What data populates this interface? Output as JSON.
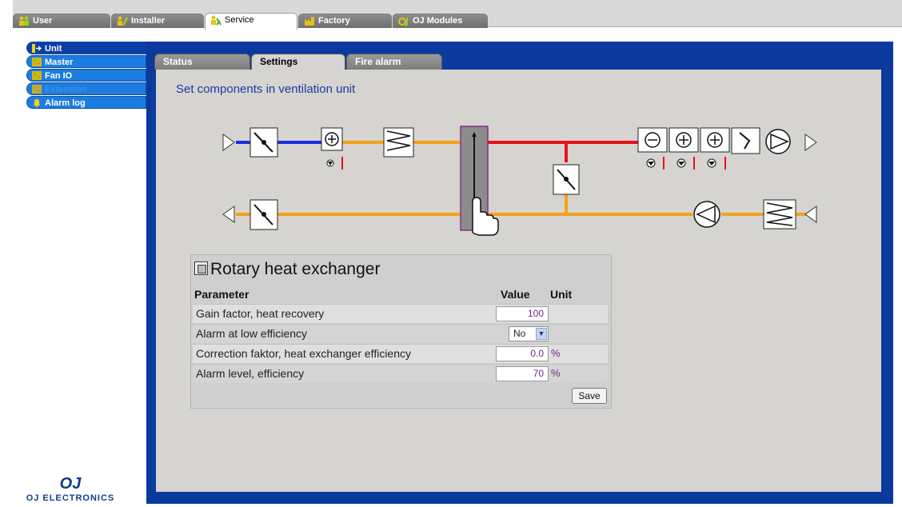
{
  "top_tabs": [
    {
      "label": "User",
      "active": false
    },
    {
      "label": "Installer",
      "active": false
    },
    {
      "label": "Service",
      "active": true
    },
    {
      "label": "Factory",
      "active": false
    },
    {
      "label": "OJ Modules",
      "active": false
    }
  ],
  "left_nav": [
    {
      "label": "Unit",
      "state": "active"
    },
    {
      "label": "Master",
      "state": "normal"
    },
    {
      "label": "Fan IO",
      "state": "normal"
    },
    {
      "label": "Extension",
      "state": "disabled"
    },
    {
      "label": "Alarm log",
      "state": "normal"
    }
  ],
  "sub_tabs": [
    {
      "label": "Status",
      "active": false
    },
    {
      "label": "Settings",
      "active": true
    },
    {
      "label": "Fire alarm",
      "active": false
    }
  ],
  "heading": "Set components in ventilation unit",
  "panel": {
    "title": "Rotary heat exchanger",
    "col_parameter": "Parameter",
    "col_value": "Value",
    "col_unit": "Unit",
    "rows": [
      {
        "label": "Gain factor, heat recovery",
        "value": "100",
        "unit": ""
      },
      {
        "label": "Alarm at low efficiency",
        "value": "No",
        "unit": "",
        "type": "select"
      },
      {
        "label": "Correction faktor, heat exchanger efficiency",
        "value": "0.0",
        "unit": "%"
      },
      {
        "label": "Alarm level, efficiency",
        "value": "70",
        "unit": "%"
      }
    ],
    "save_label": "Save"
  },
  "logo": {
    "mark": "OJ",
    "text": "OJ ELECTRONICS"
  },
  "colors": {
    "frame_blue": "#0a3a9e",
    "nav_blue": "#1c7de0",
    "duct_supply_hot": "#e8101a",
    "duct_cold": "#1a2ee0",
    "duct_orange": "#f5a11a",
    "heading": "#1a3aa0"
  }
}
